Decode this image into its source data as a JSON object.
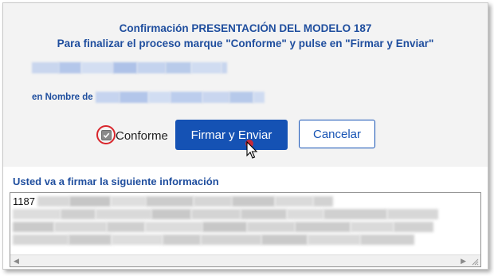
{
  "dialog": {
    "title_line1": "Confirmación PRESENTACIÓN DEL MODELO 187",
    "title_line2": "Para finalizar el proceso marque \"Conforme\" y pulse en \"Firmar y Enviar\"",
    "en_nombre_label": "en Nombre de"
  },
  "actions": {
    "conforme_label": "Conforme",
    "conforme_checked": true,
    "firmar_label": "Firmar y Enviar",
    "cancelar_label": "Cancelar"
  },
  "info": {
    "section_title": "Usted va a firmar la siguiente información",
    "first_value": "1187"
  },
  "colors": {
    "accent": "#1552b4",
    "title_text": "#1f4e9e",
    "highlight_circle": "#d9262c"
  },
  "icons": {
    "check": "checkmark-icon",
    "cursor": "mouse-pointer-icon",
    "scroll_left": "scroll-left-arrow-icon",
    "scroll_right": "scroll-right-arrow-icon",
    "resize": "resize-grip-icon"
  }
}
